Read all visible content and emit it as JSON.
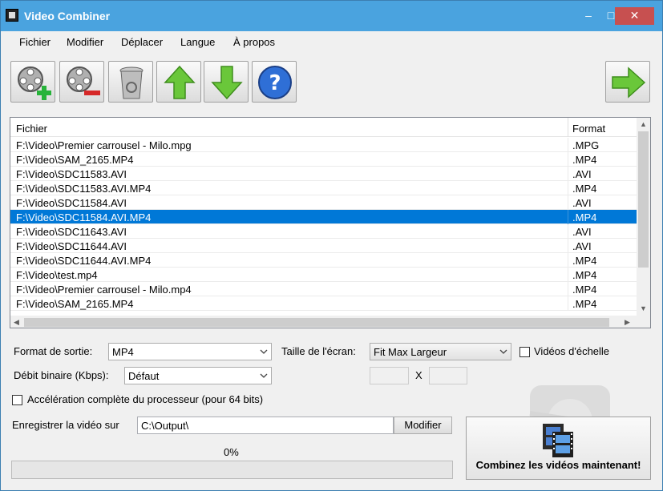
{
  "window": {
    "title": "Video Combiner",
    "minimize": "–",
    "maximize": "□",
    "close": "✕"
  },
  "menu": [
    "Fichier",
    "Modifier",
    "Déplacer",
    "Langue",
    "À propos"
  ],
  "toolbar": {
    "icons": [
      "add-video-icon",
      "remove-video-icon",
      "trash-icon",
      "arrow-up-icon",
      "arrow-down-icon",
      "help-icon",
      "arrow-right-icon"
    ]
  },
  "list": {
    "headers": {
      "file": "Fichier",
      "format": "Format"
    },
    "rows": [
      {
        "file": "F:\\Video\\Premier carrousel - Milo.mpg",
        "format": ".MPG"
      },
      {
        "file": "F:\\Video\\SAM_2165.MP4",
        "format": ".MP4"
      },
      {
        "file": "F:\\Video\\SDC11583.AVI",
        "format": ".AVI"
      },
      {
        "file": "F:\\Video\\SDC11583.AVI.MP4",
        "format": ".MP4"
      },
      {
        "file": "F:\\Video\\SDC11584.AVI",
        "format": ".AVI"
      },
      {
        "file": "F:\\Video\\SDC11584.AVI.MP4",
        "format": ".MP4",
        "selected": true
      },
      {
        "file": "F:\\Video\\SDC11643.AVI",
        "format": ".AVI"
      },
      {
        "file": "F:\\Video\\SDC11644.AVI",
        "format": ".AVI"
      },
      {
        "file": "F:\\Video\\SDC11644.AVI.MP4",
        "format": ".MP4"
      },
      {
        "file": "F:\\Video\\test.mp4",
        "format": ".MP4"
      },
      {
        "file": "F:\\Video\\Premier carrousel - Milo.mp4",
        "format": ".MP4"
      },
      {
        "file": "F:\\Video\\SAM_2165.MP4",
        "format": ".MP4"
      }
    ]
  },
  "options": {
    "output_format_label": "Format de sortie:",
    "output_format_value": "MP4",
    "screen_size_label": "Taille de l'écran:",
    "screen_size_value": "Fit Max Largeur",
    "scale_videos_label": "Vidéos d'échelle",
    "bitrate_label": "Débit binaire (Kbps):",
    "bitrate_value": "Défaut",
    "size_x_separator": "X",
    "cpu_accel_label": "Accélération complète du processeur (pour 64 bits)",
    "save_to_label": "Enregistrer la vidéo sur",
    "save_path": "C:\\Output\\",
    "modify_button": "Modifier"
  },
  "progress": {
    "text": "0%",
    "value": 0
  },
  "combine_button": "Combinez les vidéos maintenant!",
  "colors": {
    "titlebar": "#4aa3df",
    "selection": "#0078d7",
    "close": "#c75050"
  }
}
